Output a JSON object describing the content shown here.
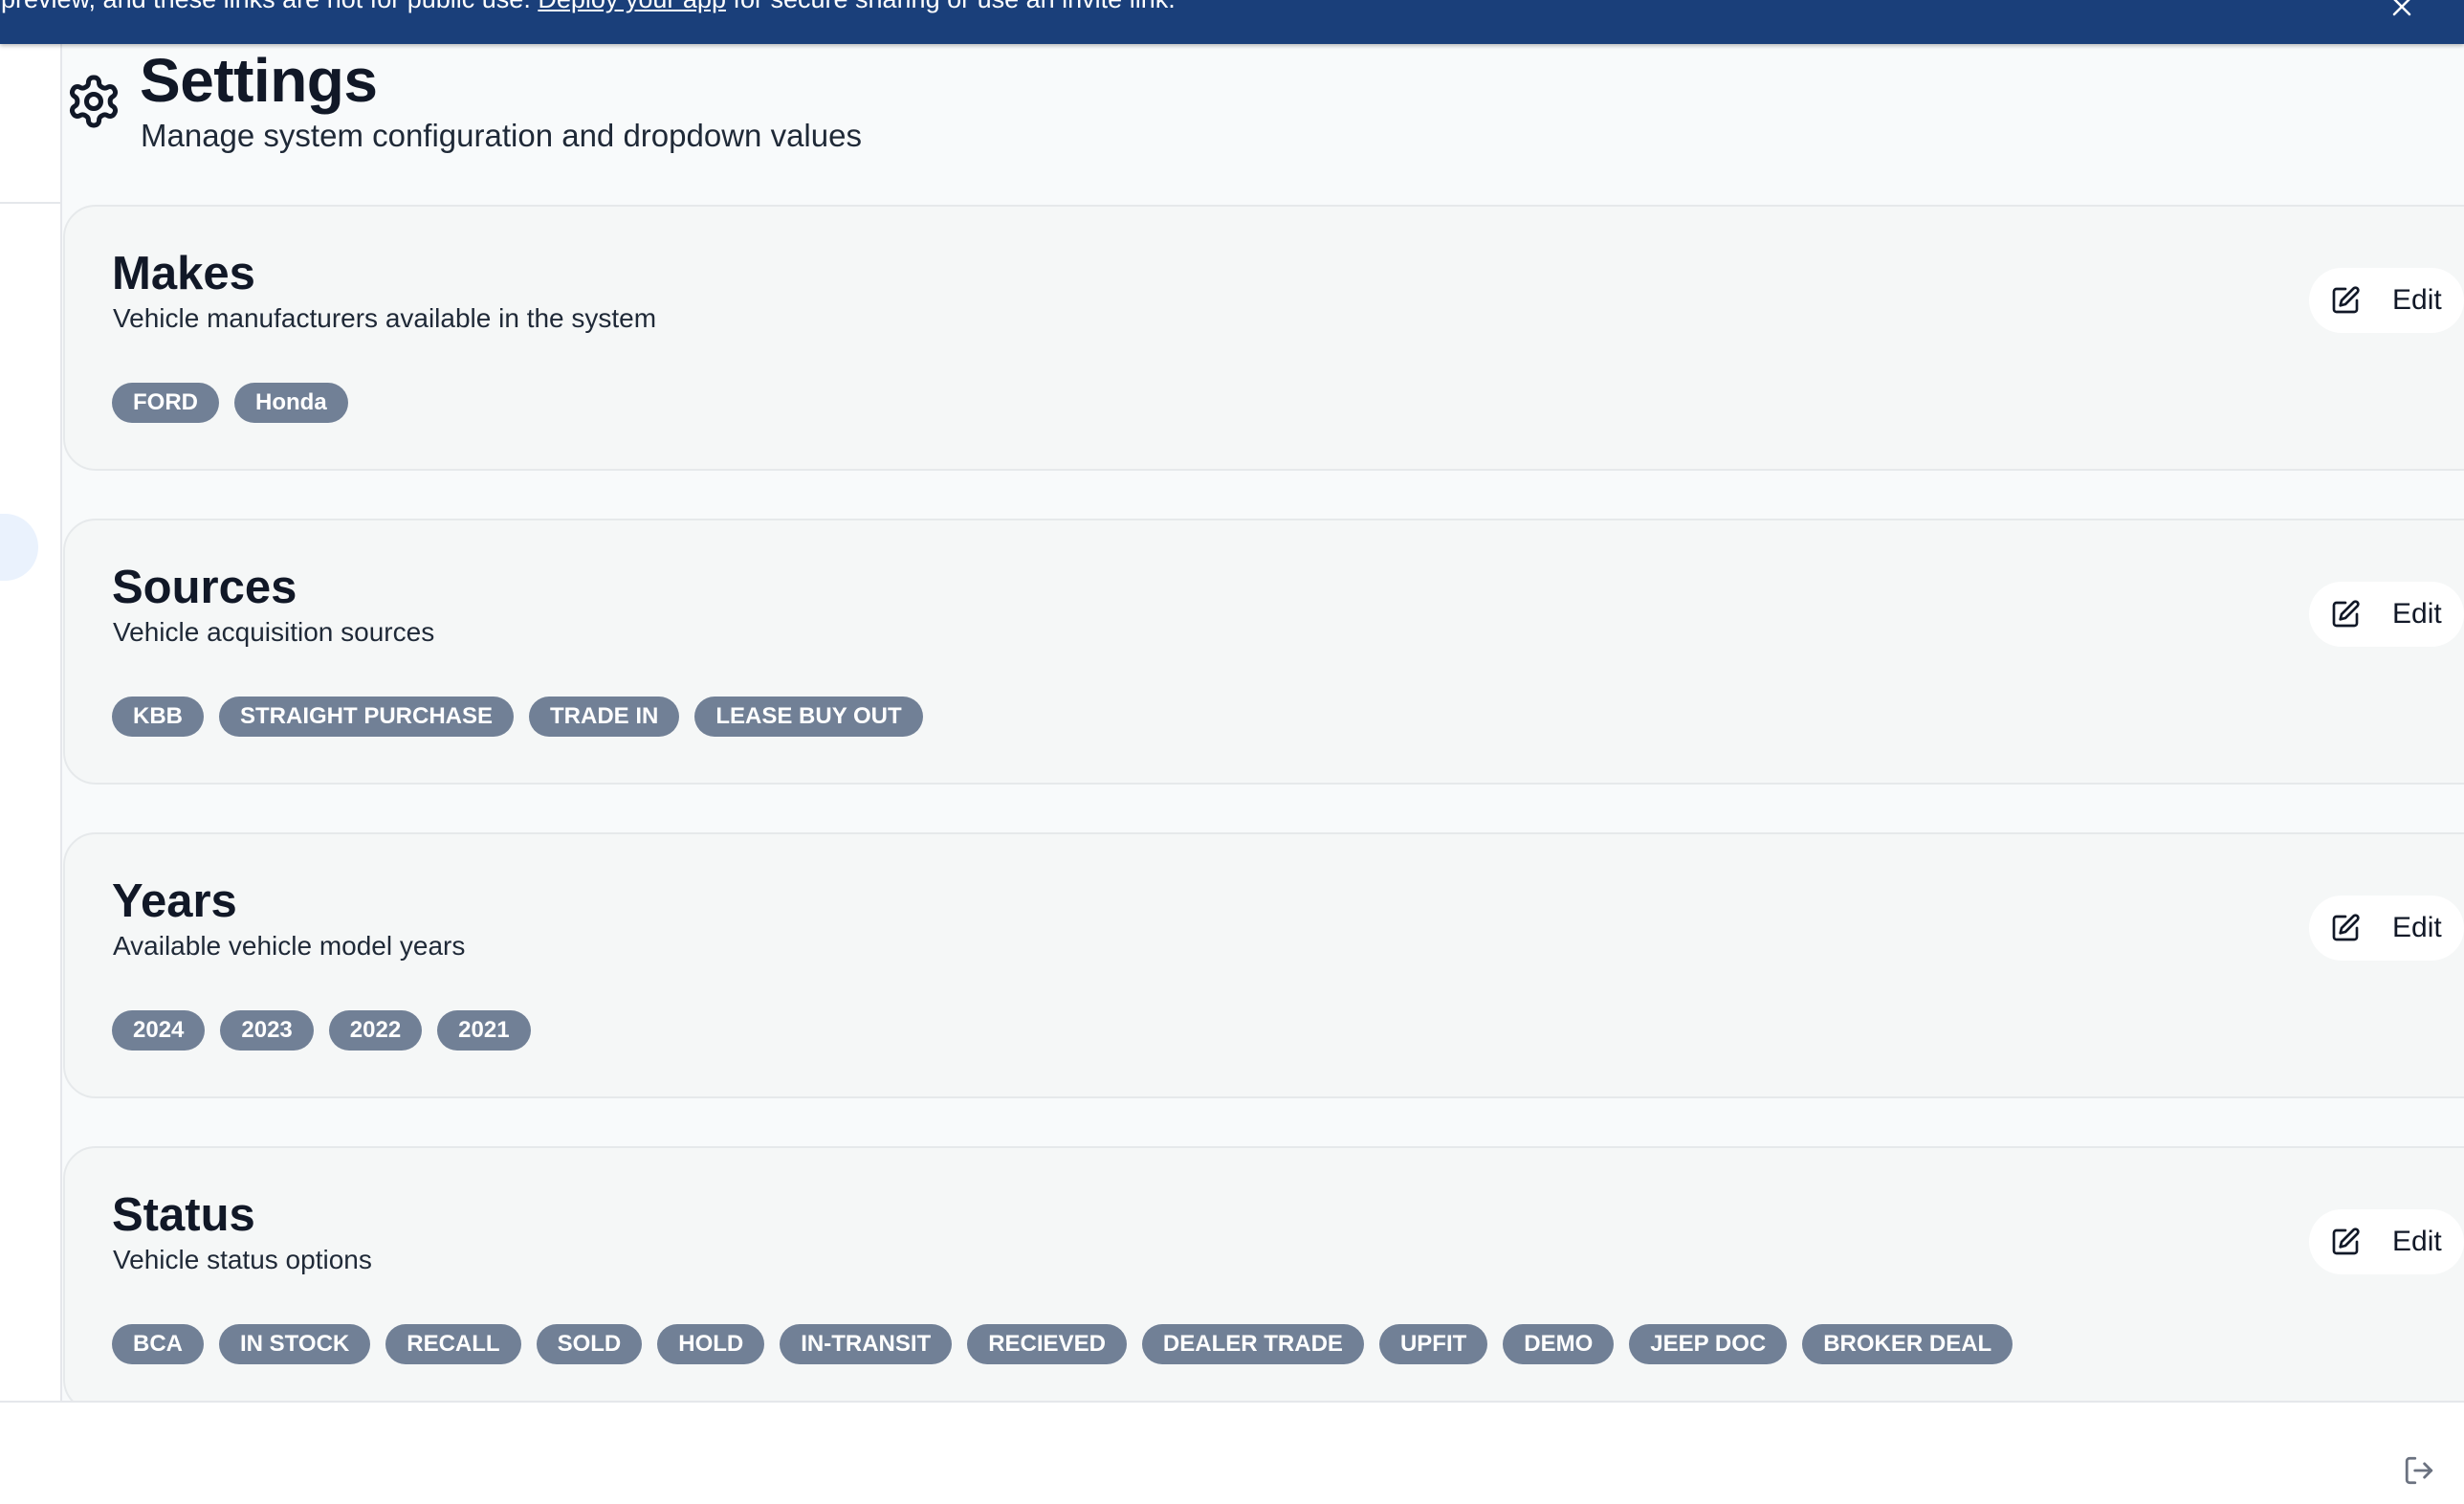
{
  "banner": {
    "text_before": "t preview, and these links are not for public use.",
    "link": "Deploy your app",
    "text_after": "for secure sharing or use an invite link.",
    "close_icon": "close-icon"
  },
  "header": {
    "icon": "gear-icon",
    "title": "Settings",
    "subtitle": "Manage system configuration and dropdown values"
  },
  "sections": [
    {
      "title": "Makes",
      "description": "Vehicle manufacturers available in the system",
      "edit_label": "Edit",
      "chips": [
        "FORD",
        "Honda"
      ]
    },
    {
      "title": "Sources",
      "description": "Vehicle acquisition sources",
      "edit_label": "Edit",
      "chips": [
        "KBB",
        "STRAIGHT PURCHASE",
        "TRADE IN",
        "LEASE BUY OUT"
      ]
    },
    {
      "title": "Years",
      "description": "Available vehicle model years",
      "edit_label": "Edit",
      "chips": [
        "2024",
        "2023",
        "2022",
        "2021"
      ]
    },
    {
      "title": "Status",
      "description": "Vehicle status options",
      "edit_label": "Edit",
      "chips": [
        "BCA",
        "IN STOCK",
        "RECALL",
        "SOLD",
        "HOLD",
        "IN-TRANSIT",
        "RECIEVED",
        "DEALER TRADE",
        "UPFIT",
        "DEMO",
        "JEEP DOC",
        "BROKER DEAL"
      ]
    }
  ],
  "footer": {
    "logout_icon": "logout-icon"
  },
  "colors": {
    "banner_bg": "#1a3f7a",
    "chip_bg": "#718096",
    "card_bg": "#f5f7f7",
    "page_bg": "#f8fafb"
  }
}
